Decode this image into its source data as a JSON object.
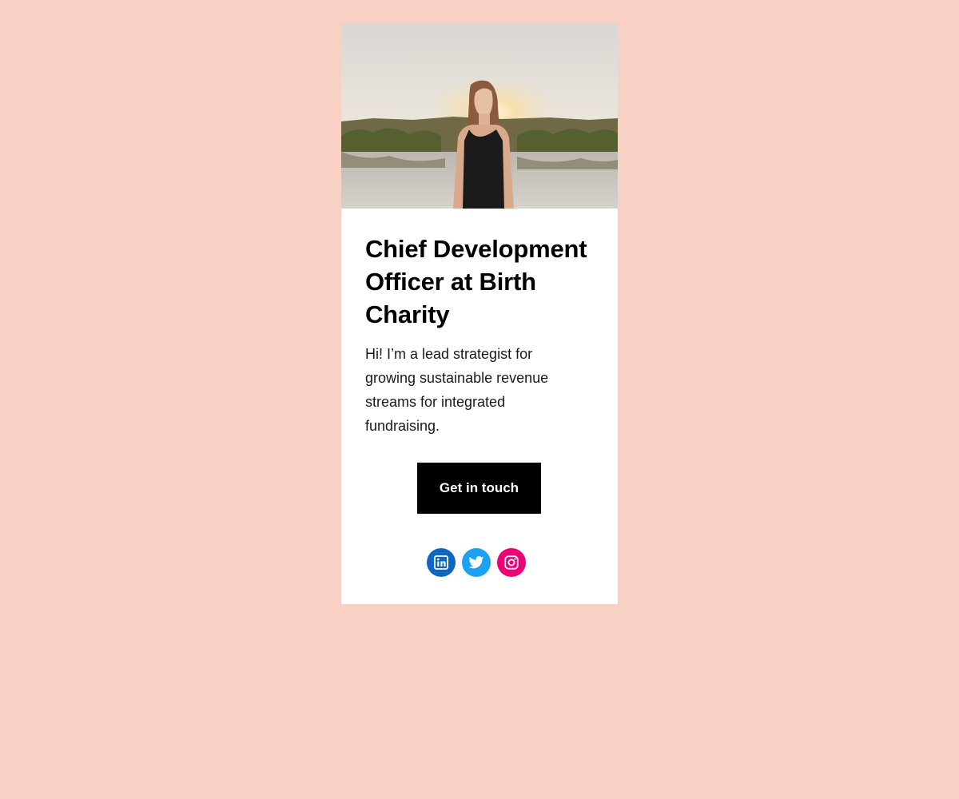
{
  "profile": {
    "title": "Chief Development Officer at Birth Charity",
    "bio": "Hi! I’m a lead strategist for growing sustainable revenue streams for integrated fundraising.",
    "cta_label": "Get in touch"
  },
  "social_links": [
    {
      "name": "LinkedIn",
      "icon": "linkedin-icon",
      "color": "#0d66c2"
    },
    {
      "name": "Twitter",
      "icon": "twitter-icon",
      "color": "#1da1f2"
    },
    {
      "name": "Instagram",
      "icon": "instagram-icon",
      "color": "#f00075"
    }
  ],
  "colors": {
    "page_background": "#f9d1c4",
    "card_background": "#ffffff",
    "button_background": "#000000",
    "button_text": "#ffffff"
  }
}
